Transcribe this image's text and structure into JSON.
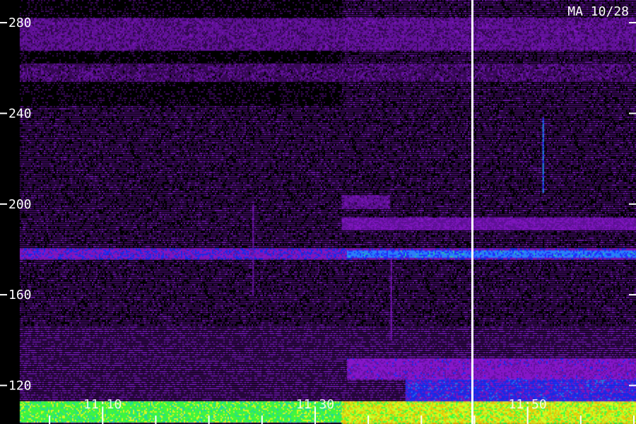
{
  "chart_data": {
    "type": "heatmap",
    "title": "MA 10/28",
    "y_ticks": [
      280,
      240,
      200,
      160,
      120
    ],
    "ylim": [
      103,
      290
    ],
    "x_ticks": [
      {
        "time": "11:10",
        "minutes": 70
      },
      {
        "time": "11:30",
        "minutes": 90
      },
      {
        "time": "11:50",
        "minutes": 110
      }
    ],
    "xlim_minutes": [
      62.2,
      120.2
    ],
    "minor_tick_interval_minutes": 5,
    "marker_line_minutes": 104.8,
    "quiet_background_end_minutes": 92.5,
    "colormap": [
      "#000000",
      "#3a0a5a",
      "#6a14a8",
      "#8a18d0",
      "#1a30ff",
      "#2090ff",
      "#20e0a0",
      "#40ff40",
      "#e0ff20",
      "#ffc000",
      "#ff4000"
    ],
    "bands": [
      {
        "y_low": 104,
        "y_high": 113,
        "from_min": 62.2,
        "to_min": 120.2,
        "level": 7.0
      },
      {
        "y_low": 176,
        "y_high": 180.5,
        "from_min": 62.2,
        "to_min": 120.2,
        "level": 3.2
      },
      {
        "y_low": 177,
        "y_high": 179.5,
        "from_min": 93.0,
        "to_min": 120.2,
        "level": 4.8
      },
      {
        "y_low": 189,
        "y_high": 194,
        "from_min": 92.5,
        "to_min": 120.2,
        "level": 2.4
      },
      {
        "y_low": 198,
        "y_high": 204,
        "from_min": 92.5,
        "to_min": 97.0,
        "level": 2.0
      },
      {
        "y_low": 268,
        "y_high": 282,
        "from_min": 62.2,
        "to_min": 120.2,
        "level": 1.8
      },
      {
        "y_low": 254,
        "y_high": 262,
        "from_min": 62.2,
        "to_min": 120.2,
        "level": 1.2
      },
      {
        "y_low": 113,
        "y_high": 123,
        "from_min": 98.5,
        "to_min": 120.2,
        "level": 3.8
      },
      {
        "y_low": 123,
        "y_high": 132,
        "from_min": 93.0,
        "to_min": 120.2,
        "level": 2.8
      }
    ],
    "spikes": [
      {
        "x_min": 111.4,
        "y_low": 205,
        "y_high": 238,
        "level": 4.5
      },
      {
        "x_min": 84.1,
        "y_low": 160,
        "y_high": 200,
        "level": 2.2
      },
      {
        "x_min": 97.1,
        "y_low": 140,
        "y_high": 176,
        "level": 2.4
      }
    ]
  }
}
